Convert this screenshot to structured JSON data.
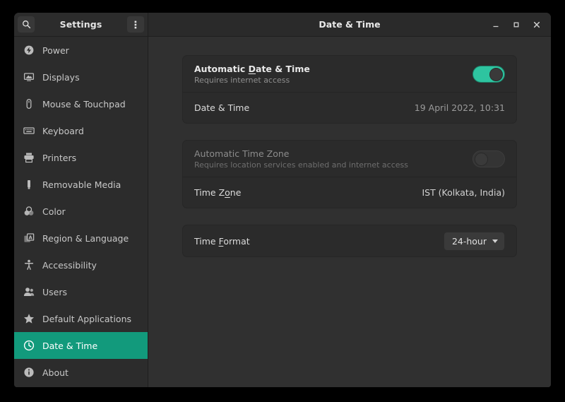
{
  "window": {
    "app_title": "Settings",
    "page_title": "Date & Time",
    "search_icon": "search-icon",
    "menu_icon": "menu-vertical-dots-icon",
    "controls": {
      "minimize": "–",
      "maximize": "▫",
      "close": "×"
    }
  },
  "sidebar": {
    "items": [
      {
        "label": "Power",
        "icon": "power-icon"
      },
      {
        "label": "Displays",
        "icon": "display-icon"
      },
      {
        "label": "Mouse & Touchpad",
        "icon": "mouse-icon"
      },
      {
        "label": "Keyboard",
        "icon": "keyboard-icon"
      },
      {
        "label": "Printers",
        "icon": "printer-icon"
      },
      {
        "label": "Removable Media",
        "icon": "usb-drive-icon"
      },
      {
        "label": "Color",
        "icon": "color-circles-icon"
      },
      {
        "label": "Region & Language",
        "icon": "language-icon"
      },
      {
        "label": "Accessibility",
        "icon": "accessibility-icon"
      },
      {
        "label": "Users",
        "icon": "users-icon"
      },
      {
        "label": "Default Applications",
        "icon": "star-icon"
      },
      {
        "label": "Date & Time",
        "icon": "clock-icon"
      },
      {
        "label": "About",
        "icon": "info-icon"
      }
    ],
    "active_index": 11
  },
  "main": {
    "cards": [
      {
        "rows": [
          {
            "title_pre": "Automatic ",
            "title_mnemonic": "D",
            "title_post": "ate & Time",
            "subtitle": "Requires internet access",
            "control": "toggle",
            "toggle_state": "on"
          },
          {
            "title": "Date & Time",
            "value": "19 April 2022, 10:31",
            "control": "value"
          }
        ]
      },
      {
        "rows": [
          {
            "title": "Automatic Time Zone",
            "subtitle": "Requires location services enabled and internet access",
            "control": "toggle",
            "toggle_state": "off",
            "disabled": true
          },
          {
            "title_pre": "Time Z",
            "title_mnemonic": "o",
            "title_post": "ne",
            "value": "IST (Kolkata, India)",
            "control": "value"
          }
        ]
      },
      {
        "rows": [
          {
            "title_pre": "Time ",
            "title_mnemonic": "F",
            "title_post": "ormat",
            "control": "dropdown",
            "dropdown_value": "24-hour"
          }
        ]
      }
    ]
  },
  "colors": {
    "accent_selected": "#129a7c",
    "toggle_on": "#2ec4a0",
    "window_bg": "#303030",
    "sidebar_bg": "#2c2c2c",
    "card_bg": "#2b2b2b",
    "headerbar_bg": "#2a2a2a"
  }
}
